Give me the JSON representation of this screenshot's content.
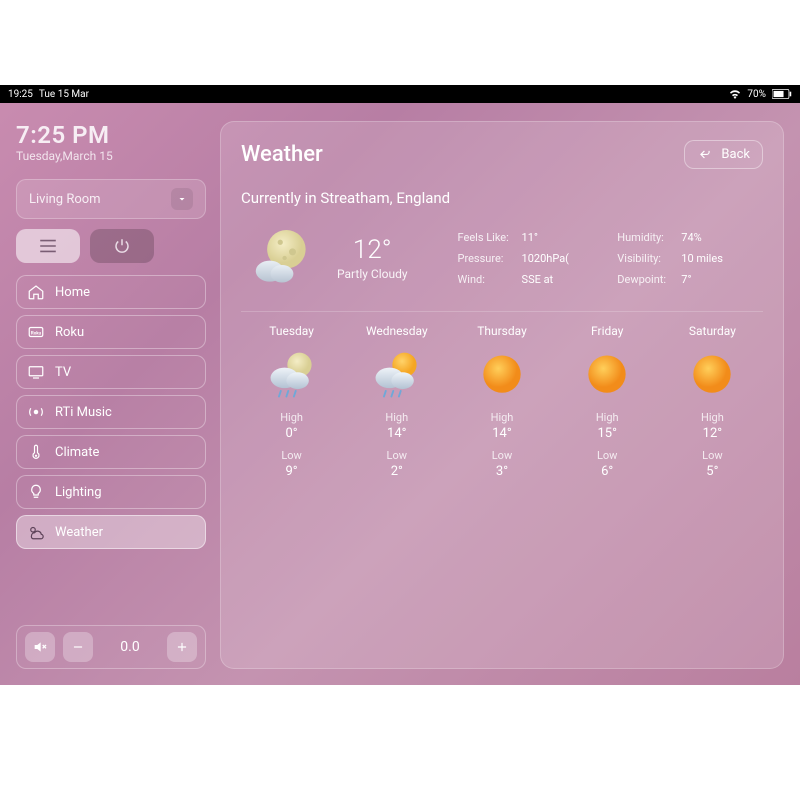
{
  "status": {
    "time": "19:25",
    "date": "Tue 15 Mar",
    "battery": "70%"
  },
  "clock": {
    "time": "7:25 PM",
    "date": "Tuesday,March 15"
  },
  "room": {
    "label": "Living Room"
  },
  "nav": {
    "items": [
      {
        "label": "Home"
      },
      {
        "label": "Roku"
      },
      {
        "label": "TV"
      },
      {
        "label": "RTi Music"
      },
      {
        "label": "Climate"
      },
      {
        "label": "Lighting"
      },
      {
        "label": "Weather"
      }
    ]
  },
  "volume": {
    "value": "0.0"
  },
  "panel": {
    "title": "Weather",
    "back": "Back",
    "location": "Currently in Streatham, England"
  },
  "current": {
    "temp": "12°",
    "condition": "Partly Cloudy",
    "stats": {
      "feels_label": "Feels Like:",
      "feels_val": "11°",
      "humidity_label": "Humidity:",
      "humidity_val": "74%",
      "pressure_label": "Pressure:",
      "pressure_val": "1020hPa(",
      "visibility_label": "Visibility:",
      "visibility_val": "10 miles",
      "wind_label": "Wind:",
      "wind_val": "SSE at",
      "dewpoint_label": "Dewpoint:",
      "dewpoint_val": "7°"
    }
  },
  "forecast": [
    {
      "day": "Tuesday",
      "high_label": "High",
      "high": "0°",
      "low_label": "Low",
      "low": "9°",
      "icon": "night-rain"
    },
    {
      "day": "Wednesday",
      "high_label": "High",
      "high": "14°",
      "low_label": "Low",
      "low": "2°",
      "icon": "sun-rain"
    },
    {
      "day": "Thursday",
      "high_label": "High",
      "high": "14°",
      "low_label": "Low",
      "low": "3°",
      "icon": "sun"
    },
    {
      "day": "Friday",
      "high_label": "High",
      "high": "15°",
      "low_label": "Low",
      "low": "6°",
      "icon": "sun"
    },
    {
      "day": "Saturday",
      "high_label": "High",
      "high": "12°",
      "low_label": "Low",
      "low": "5°",
      "icon": "sun"
    }
  ]
}
